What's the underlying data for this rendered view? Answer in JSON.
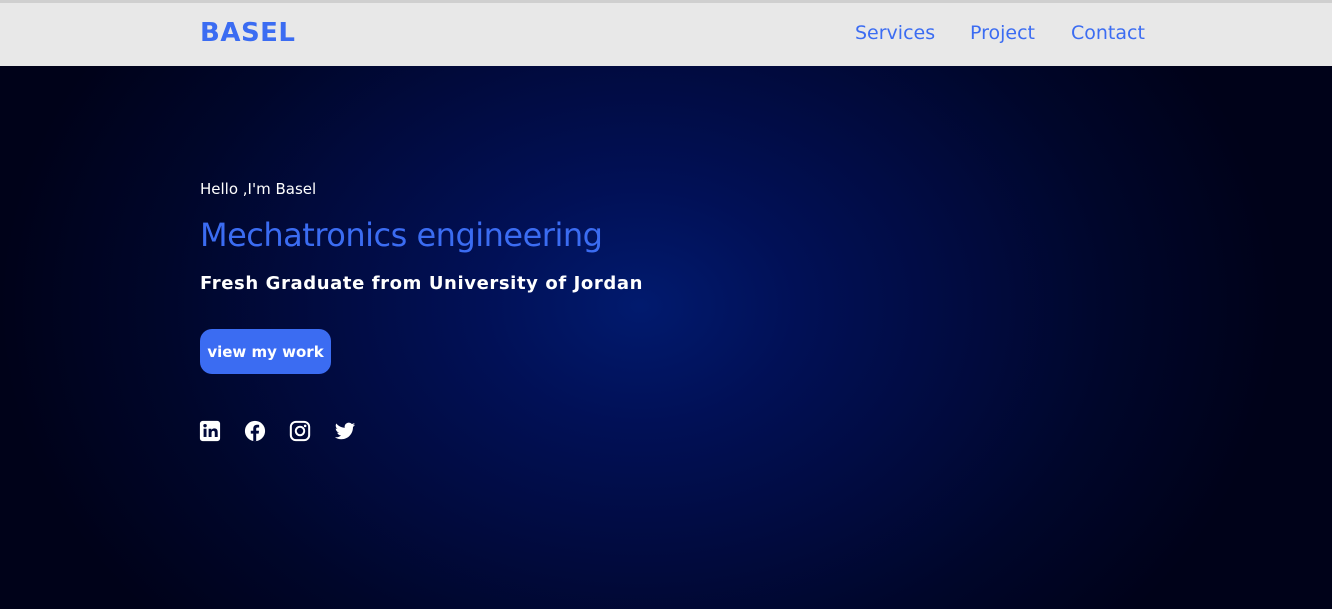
{
  "header": {
    "logo": "BASEL",
    "nav": [
      {
        "label": "Services"
      },
      {
        "label": "Project"
      },
      {
        "label": "Contact"
      }
    ]
  },
  "hero": {
    "greeting": "Hello ,I'm Basel",
    "role": "Mechatronics engineering",
    "subtitle": "Fresh Graduate from University of Jordan",
    "cta_label": "view my work",
    "socials": [
      {
        "icon": "linkedin-icon"
      },
      {
        "icon": "facebook-icon"
      },
      {
        "icon": "instagram-icon"
      },
      {
        "icon": "twitter-icon"
      }
    ]
  },
  "colors": {
    "accent": "#3b6cf2",
    "header_bg": "#e8e8e8",
    "hero_bg_center": "#011a6e",
    "hero_bg_edge": "#000219",
    "text_light": "#ffffff"
  }
}
